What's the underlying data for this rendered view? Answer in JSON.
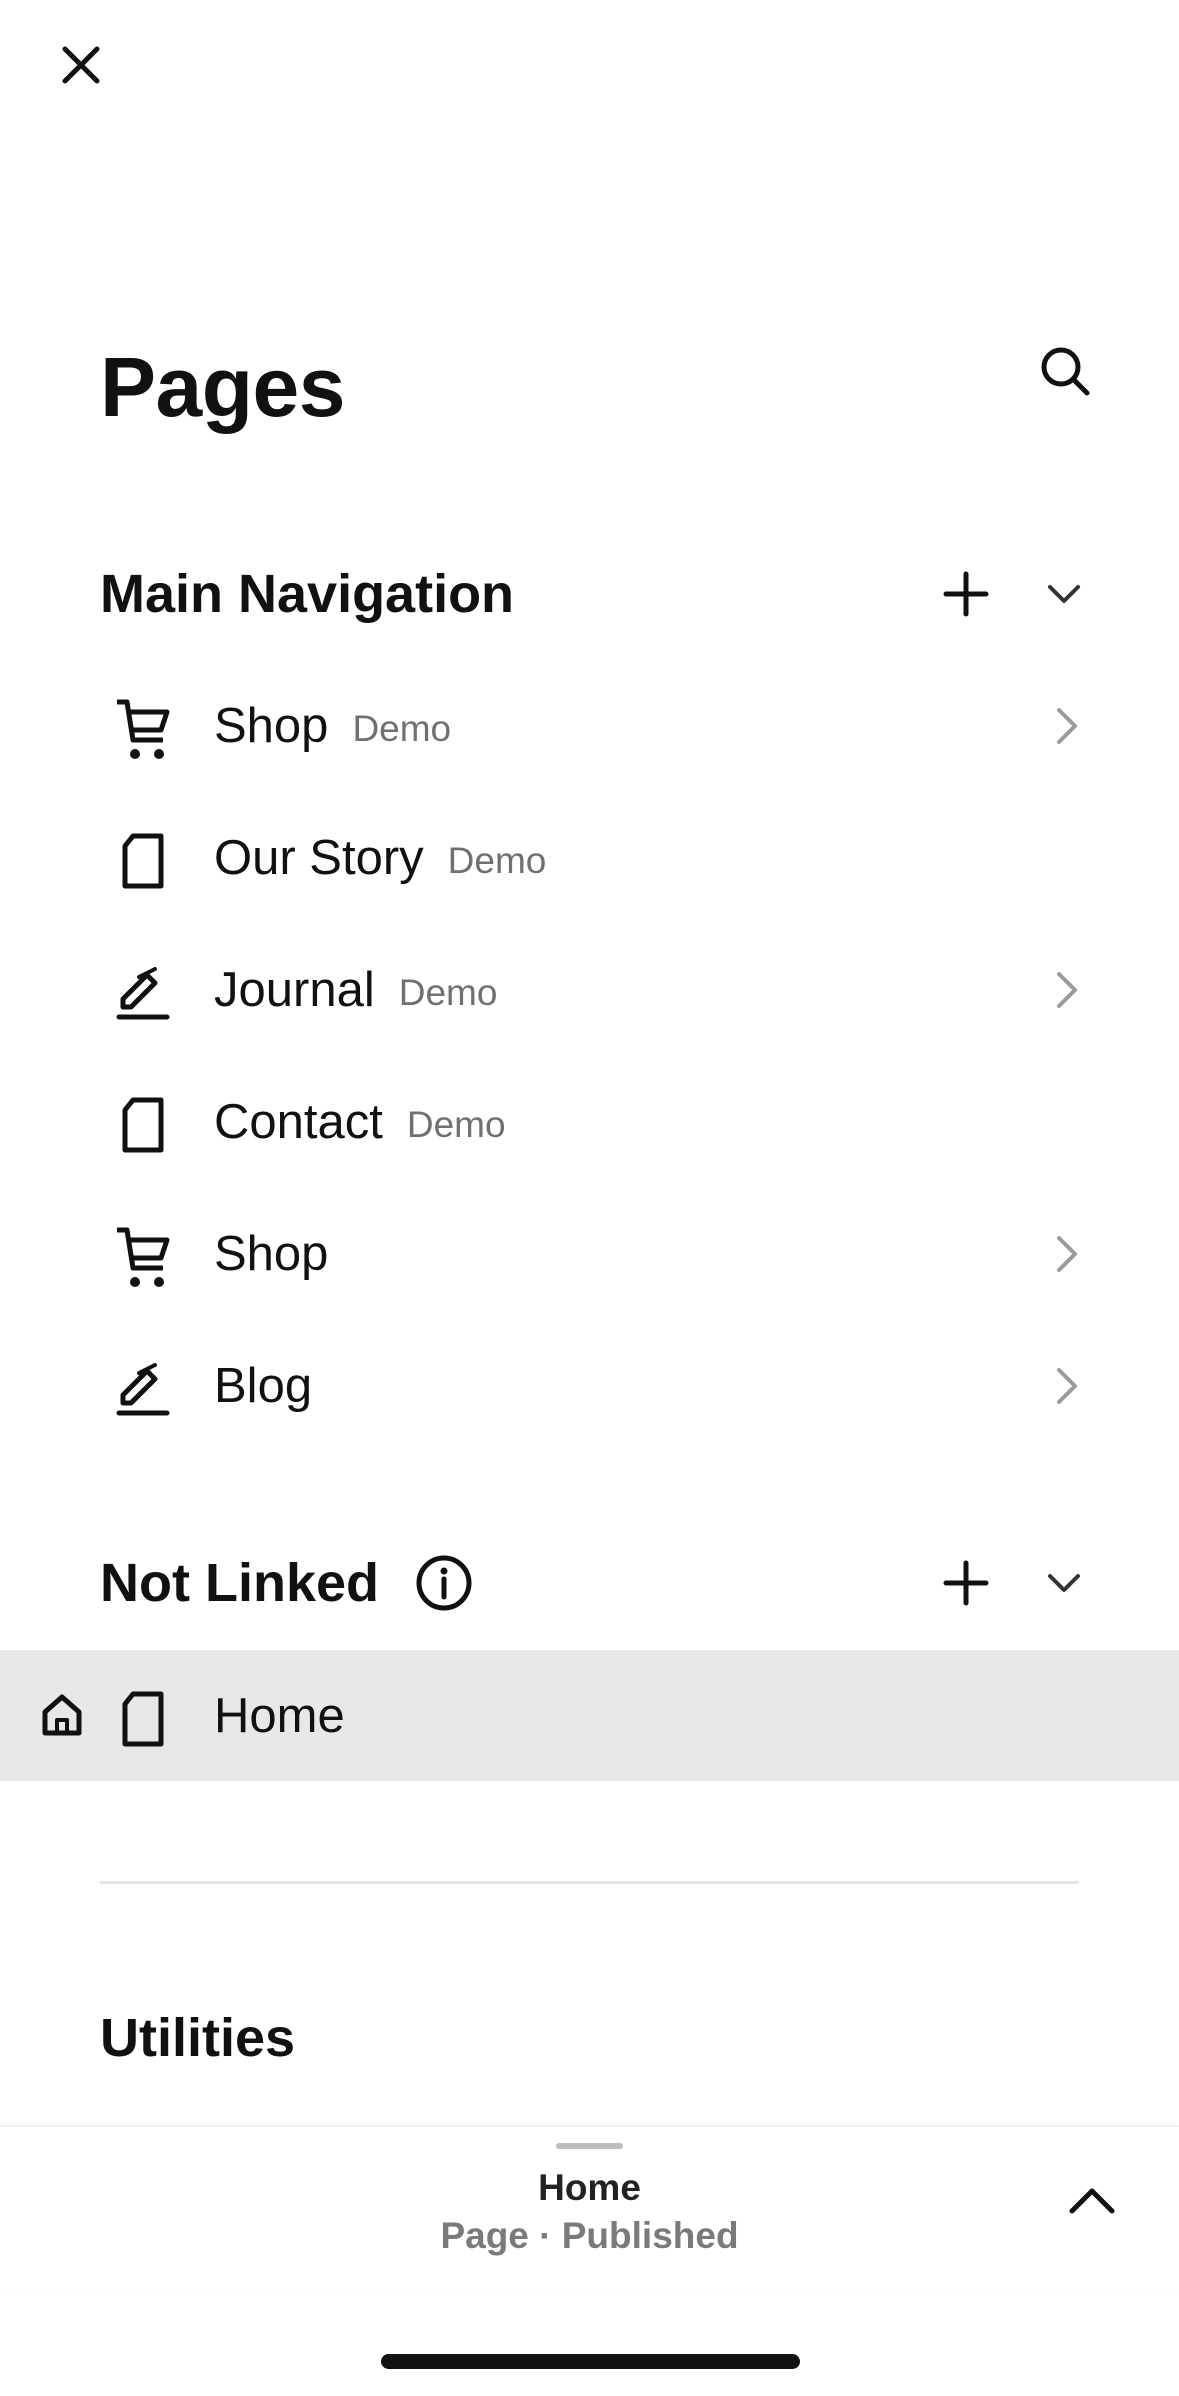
{
  "header": {
    "close_icon": "close-icon",
    "title": "Pages",
    "search_icon": "search-icon"
  },
  "main_navigation": {
    "title": "Main Navigation",
    "add_icon": "plus-icon",
    "collapse_icon": "chevron-down-icon",
    "items": [
      {
        "label": "Shop",
        "tag": "Demo",
        "icon": "cart-icon",
        "has_chevron": true
      },
      {
        "label": "Our Story",
        "tag": "Demo",
        "icon": "page-icon",
        "has_chevron": false
      },
      {
        "label": "Journal",
        "tag": "Demo",
        "icon": "blog-icon",
        "has_chevron": true
      },
      {
        "label": "Contact",
        "tag": "Demo",
        "icon": "page-icon",
        "has_chevron": false
      },
      {
        "label": "Shop",
        "tag": "",
        "icon": "cart-icon",
        "has_chevron": true
      },
      {
        "label": "Blog",
        "tag": "",
        "icon": "blog-icon",
        "has_chevron": true
      }
    ]
  },
  "not_linked": {
    "title": "Not Linked",
    "info_icon": "info-icon",
    "add_icon": "plus-icon",
    "collapse_icon": "chevron-down-icon",
    "items": [
      {
        "label": "Home",
        "icon": "page-icon",
        "is_homepage": true,
        "selected": true
      }
    ]
  },
  "utilities": {
    "title": "Utilities"
  },
  "bottom_panel": {
    "title": "Home",
    "subtitle": "Page · Published",
    "expand_icon": "chevron-up-icon"
  },
  "colors": {
    "text": "#111111",
    "muted": "#707070",
    "selected_row": "#e8e8e8",
    "chevron": "#9a9a9a"
  }
}
